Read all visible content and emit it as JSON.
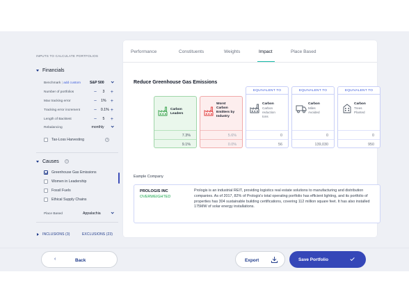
{
  "sidebar": {
    "heading": "INPUTS TO CALCULATE PORTFOLIOS",
    "financials_title": "Financials",
    "benchmark": {
      "label": "Benchmark",
      "link": "add custom",
      "value": "S&P 500"
    },
    "params": [
      {
        "label": "Number of portfolios",
        "value": "3"
      },
      {
        "label": "Max tracking error",
        "value": "1%"
      },
      {
        "label": "Tracking error increment",
        "value": "0.1%"
      },
      {
        "label": "Length of Backtest",
        "value": "5"
      }
    ],
    "rebalancing": {
      "label": "Rebalancing",
      "value": "monthly"
    },
    "tax_loss": {
      "label": "Tax-Loss Harvesting",
      "info": "?"
    },
    "causes_title": "Causes",
    "causes_info": "?",
    "causes": [
      {
        "label": "Greenhouse Gas Emissions",
        "checked": true
      },
      {
        "label": "Women in Leadership",
        "checked": false
      },
      {
        "label": "Fossil Fuels",
        "checked": false
      },
      {
        "label": "Ethical Supply Chains",
        "checked": false
      }
    ],
    "place_based": {
      "label": "Place Based",
      "value": "Appalachia"
    },
    "inclusions": "INCLUSIONS (3)",
    "exclusions": "EXCLUSIONS (23)"
  },
  "tabs": [
    {
      "label": "Performance",
      "active": false
    },
    {
      "label": "Constituents",
      "active": false
    },
    {
      "label": "Weights",
      "active": false
    },
    {
      "label": "Impact",
      "active": true
    },
    {
      "label": "Place Based",
      "active": false
    }
  ],
  "impact": {
    "title": "Reduce Greenhouse Gas Emissions",
    "carbon_leaders": {
      "label_lines": [
        "Carbon",
        "Leaders"
      ],
      "values": [
        "7.3%",
        "9.1%"
      ]
    },
    "worst_emitters": {
      "label_lines": [
        "Worst",
        "Carbon",
        "Emitters by",
        "Industry"
      ],
      "values": [
        "5.6%",
        "0.0%"
      ]
    },
    "equivalents": [
      {
        "head": "EQUIVALENT TO",
        "title": "Carbon",
        "sub_lines": [
          "Carbon",
          "reduction",
          "tons"
        ],
        "values": [
          "0",
          "56"
        ]
      },
      {
        "head": "EQUIVALENT TO",
        "title": "Carbon",
        "sub_lines": [
          "Miles",
          "Avoided"
        ],
        "values": [
          "0",
          "139,030"
        ]
      },
      {
        "head": "EQUIVALENT TO",
        "title": "Carbon",
        "sub_lines": [
          "Trees",
          "Planted"
        ],
        "values": [
          "0",
          "950"
        ]
      }
    ],
    "example_label": "Eample Company",
    "example": {
      "name": "PROLOGIS INC",
      "status": "OVERWEIGHTED",
      "description": "Prologis is an industrial REIT, providing logistics real estate solutions to manufacturing and distribution companies. As of 2017, 82% of Prologis's total operating portfolio has efficient lighting, and its portfolio of properties has 304 sustainable building certifications, covering 112 million square feet. It has also installed 175MW of solar energy installations."
    }
  },
  "footer": {
    "back": "Back",
    "export": "Export",
    "save": "Save Portfolio"
  },
  "colors": {
    "accent": "#3547b8",
    "tab_underline": "#14b8a6",
    "green_fill": "#eaf7ec",
    "red_fill": "#fdeeee",
    "status_green": "#16a34a"
  }
}
